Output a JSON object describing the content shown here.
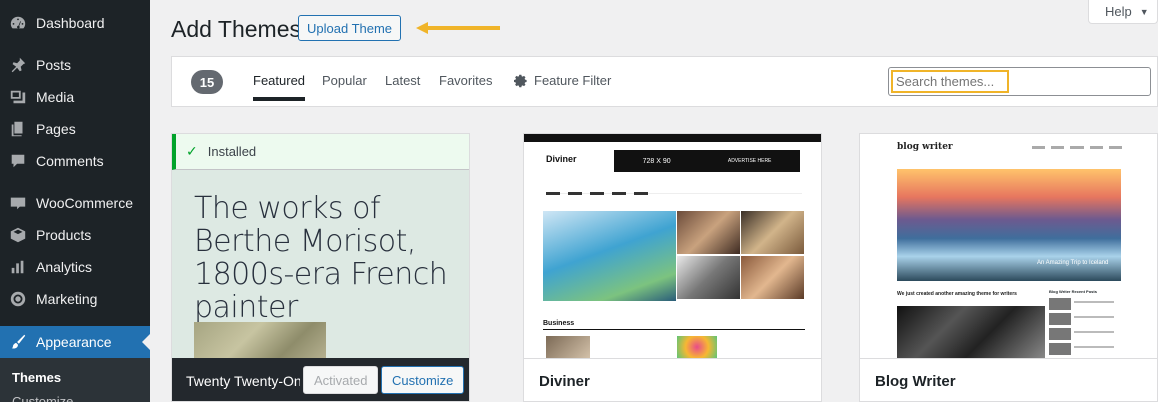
{
  "sidebar": {
    "items": [
      {
        "label": "Dashboard",
        "icon": "dashboard-icon"
      },
      {
        "label": "Posts",
        "icon": "pin-icon"
      },
      {
        "label": "Media",
        "icon": "media-icon"
      },
      {
        "label": "Pages",
        "icon": "pages-icon"
      },
      {
        "label": "Comments",
        "icon": "comment-icon"
      },
      {
        "label": "WooCommerce",
        "icon": "woocommerce-icon"
      },
      {
        "label": "Products",
        "icon": "box-icon"
      },
      {
        "label": "Analytics",
        "icon": "bar-chart-icon"
      },
      {
        "label": "Marketing",
        "icon": "megaphone-icon"
      },
      {
        "label": "Appearance",
        "icon": "paintbrush-icon"
      }
    ],
    "submenu": {
      "current": "Themes",
      "next": "Customize"
    }
  },
  "header": {
    "title": "Add Themes",
    "upload_label": "Upload Theme",
    "help_label": "Help"
  },
  "filter_bar": {
    "count": "15",
    "tabs": [
      "Featured",
      "Popular",
      "Latest",
      "Favorites"
    ],
    "feature_filter": "Feature Filter",
    "search_placeholder": "Search themes..."
  },
  "themes": [
    {
      "name": "Twenty Twenty-One",
      "installed_label": "Installed",
      "heading": "The works of Berthe Morisot, 1800s-era French painter",
      "activated_label": "Activated",
      "customize_label": "Customize"
    },
    {
      "name": "Diviner",
      "shot": {
        "logo": "Diviner",
        "ad": "728 X 90",
        "ad_label": "ADVERTISE HERE",
        "section": "Business"
      }
    },
    {
      "name": "Blog Writer",
      "shot": {
        "logo": "blog writer",
        "caption": "An Amazing Trip to Iceland",
        "post_title": "We just created another amazing theme for writers",
        "side_title": "Blog Writer Recent Posts"
      }
    }
  ],
  "colors": {
    "accent": "#2271b1",
    "sidebar": "#1d2327",
    "highlight": "#f0b429",
    "installed": "#00a32a"
  }
}
